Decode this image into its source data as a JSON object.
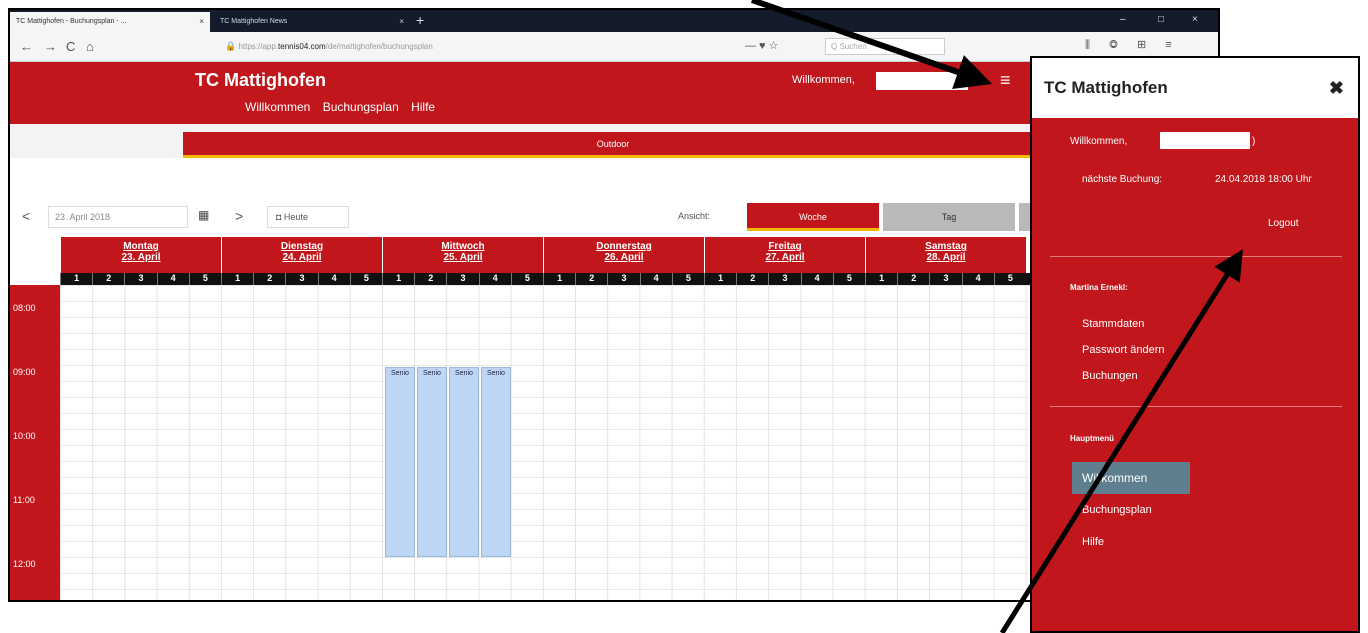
{
  "browser": {
    "tabs": [
      {
        "title": "TC Mattighofen - Buchungsplan - ...",
        "close": "×"
      },
      {
        "title": "TC Mattighofen News",
        "close": "×"
      }
    ],
    "new_tab": "+",
    "window_controls": [
      "–",
      "□",
      "×"
    ],
    "nav": {
      "back": "←",
      "forward": "→",
      "reload": "C",
      "home": "⌂"
    },
    "url_prefix": "https://app.",
    "url_domain": "tennis04.com",
    "url_suffix": "/de/mattighofen/buchungsplan",
    "url_icons": "— ♥ ☆",
    "search_placeholder": "Q Suchen",
    "toolbar_icons": "⫼ ◎ ⊞ ≡"
  },
  "app": {
    "brand": "TC Mattighofen",
    "nav_items": [
      "Willkommen",
      "Buchungsplan",
      "Hilfe"
    ],
    "welcome": "Willkommen,",
    "separator": "|",
    "menu_icon": "≡",
    "outdoor_tab": "Outdoor"
  },
  "toolbar": {
    "prev": "<",
    "next": ">",
    "date": "23. April 2018",
    "calendar_icon": "▦",
    "today": "◘ Heute",
    "view_label": "Ansicht:",
    "view_week": "Woche",
    "view_day": "Tag"
  },
  "calendar": {
    "days": [
      {
        "name": "Montag",
        "date": "23. April"
      },
      {
        "name": "Dienstag",
        "date": "24. April"
      },
      {
        "name": "Mittwoch",
        "date": "25. April"
      },
      {
        "name": "Donnerstag",
        "date": "26. April"
      },
      {
        "name": "Freitag",
        "date": "27. April"
      },
      {
        "name": "Samstag",
        "date": "28. April"
      }
    ],
    "courts": [
      "1",
      "2",
      "3",
      "4",
      "5"
    ],
    "times": [
      "08:00",
      "09:00",
      "10:00",
      "11:00",
      "12:00"
    ],
    "bookings": [
      "Senio",
      "Senio",
      "Senio",
      "Senio"
    ]
  },
  "panel": {
    "title": "TC Mattighofen",
    "close": "✖",
    "welcome": "Willkommen,",
    "welcome_end": ")",
    "next_booking_label": "nächste Buchung:",
    "next_booking_value": "24.04.2018 18:00 Uhr",
    "logout": "Logout",
    "user_heading": "Martina Ernekl:",
    "user_links": [
      "Stammdaten",
      "Passwort ändern",
      "Buchungen"
    ],
    "main_menu_heading": "Hauptmenü",
    "main_links": [
      "Willkommen",
      "Buchungsplan",
      "Hilfe"
    ]
  }
}
